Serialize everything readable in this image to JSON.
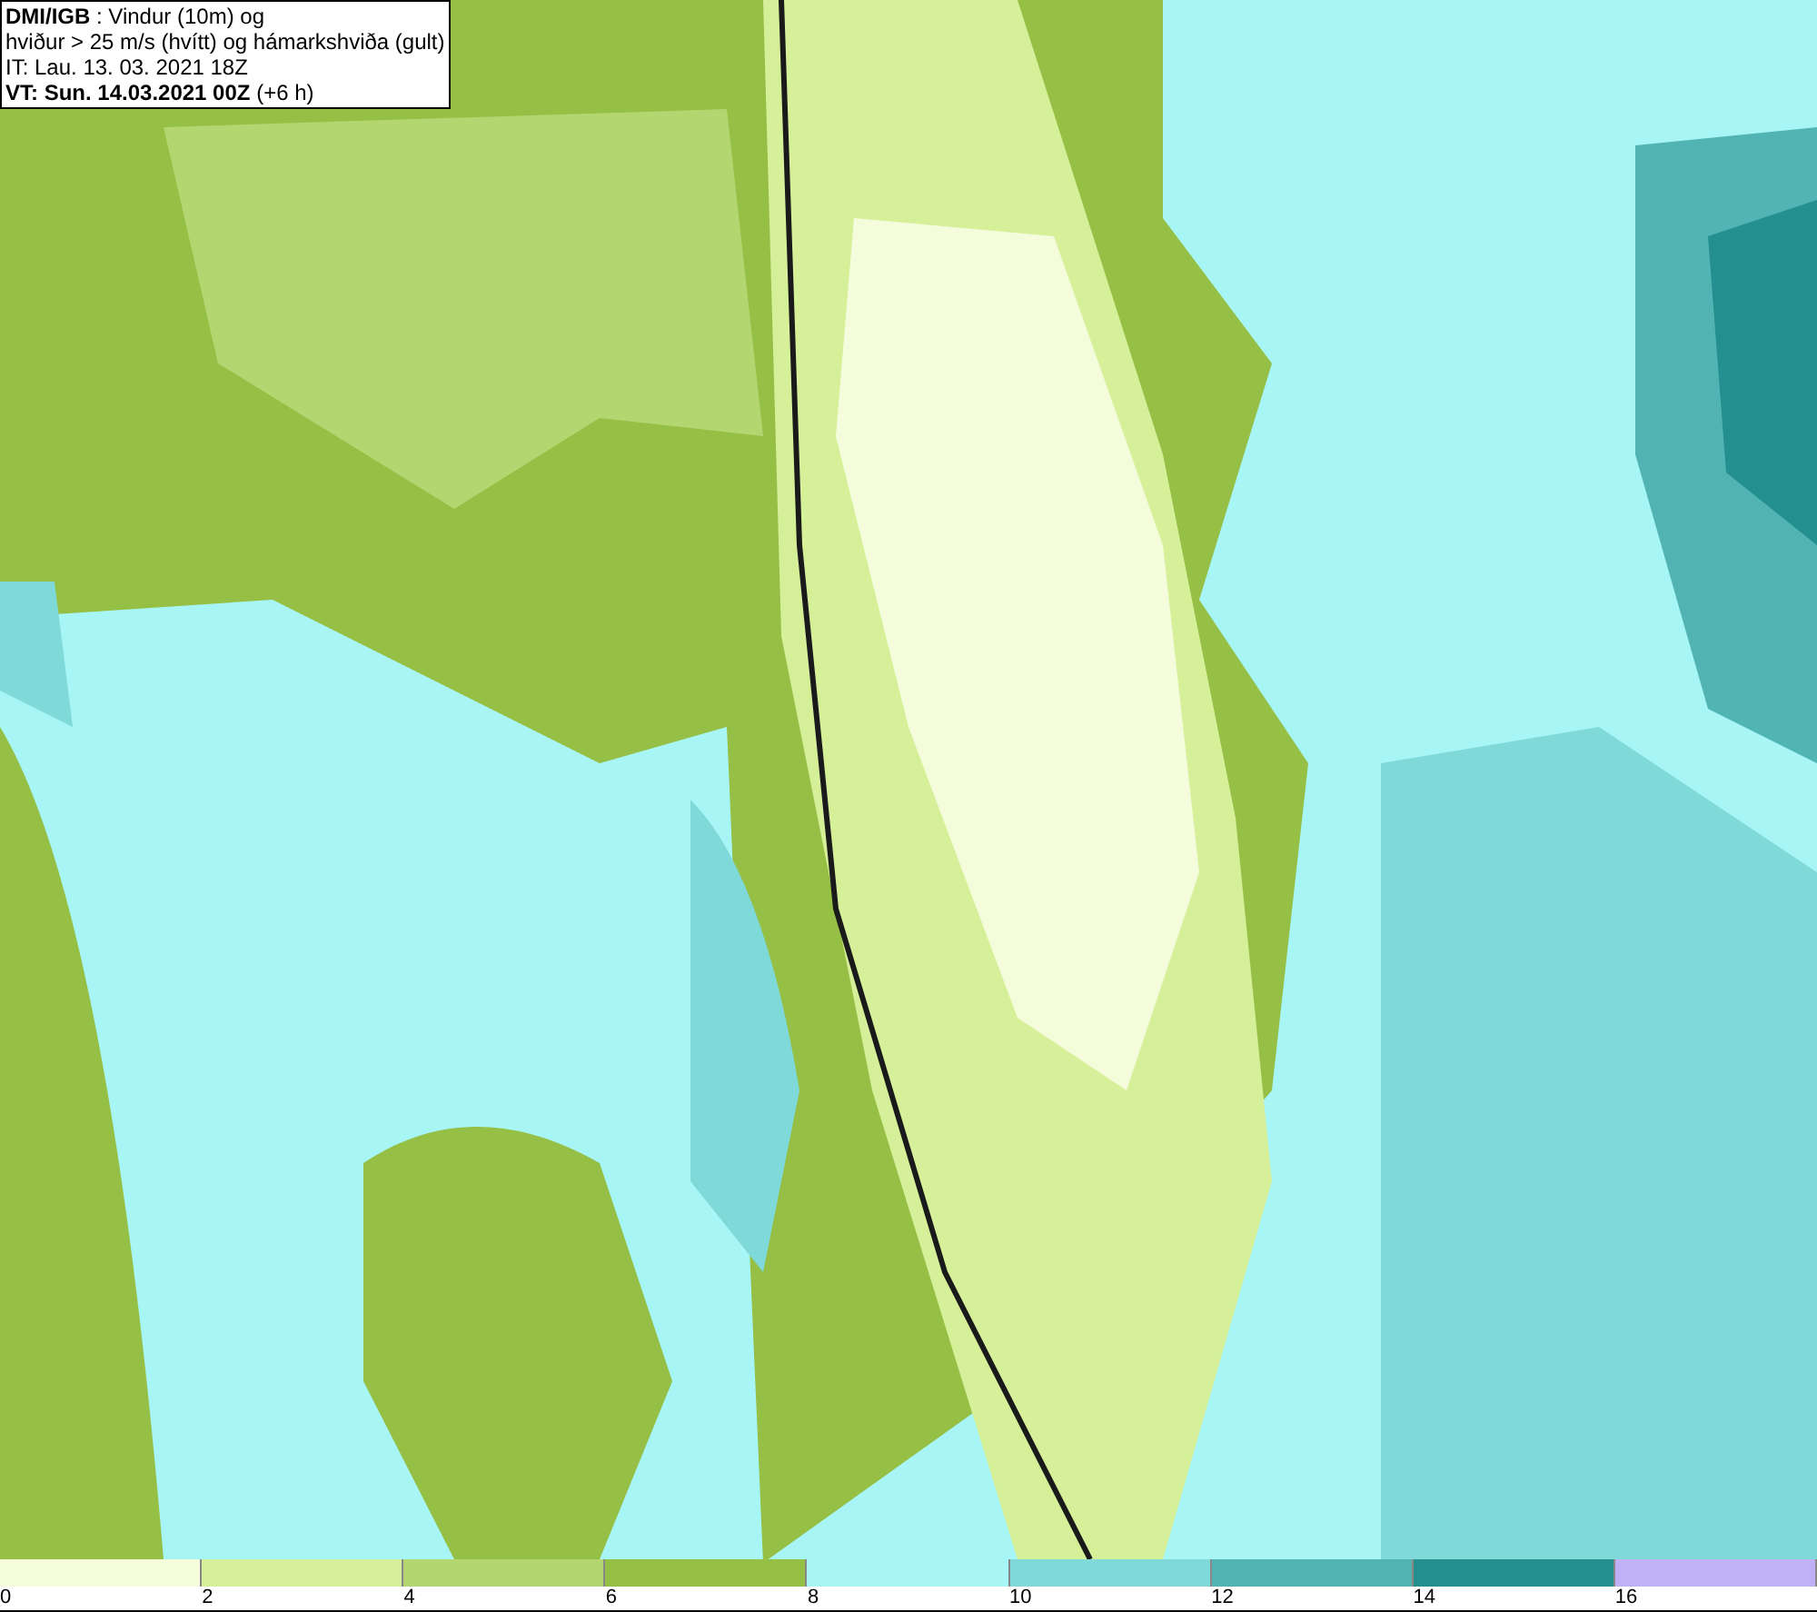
{
  "header": {
    "lines": [
      "**DMI/IGB** : Vindur (10m) og",
      "hviður > 25 m/s (hvítt) og hámarkshviða (gult)",
      "IT: Lau. 13. 03. 2021 18Z",
      "**VT: Sun. 14.03.2021 00Z** (+6 h)"
    ]
  },
  "legend": [
    {
      "label": "0",
      "color": "#f5fcdc"
    },
    {
      "label": "2",
      "color": "#d6f09a"
    },
    {
      "label": "4",
      "color": "#b3d670"
    },
    {
      "label": "6",
      "color": "#96bf45"
    },
    {
      "label": "8",
      "color": "#a8f5f5"
    },
    {
      "label": "10",
      "color": "#80d9d9"
    },
    {
      "label": "12",
      "color": "#52b3b3"
    },
    {
      "label": "14",
      "color": "#248f8f"
    },
    {
      "label": "16",
      "color": "#c0b0f5"
    }
  ]
}
